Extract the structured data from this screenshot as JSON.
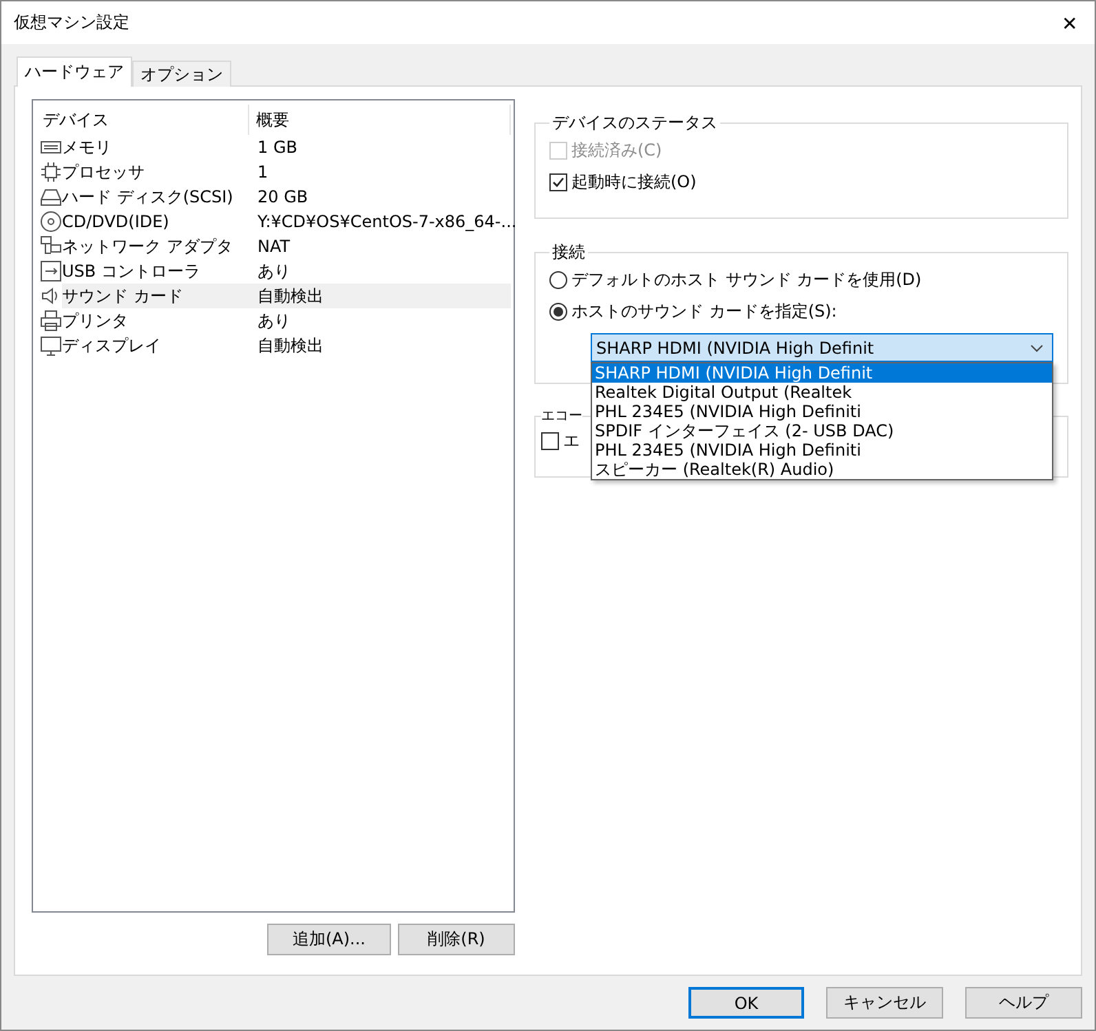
{
  "window": {
    "title": "仮想マシン設定",
    "close": "✕"
  },
  "tabs": [
    {
      "label": "ハードウェア",
      "selected": true
    },
    {
      "label": "オプション",
      "selected": false
    }
  ],
  "device_list": {
    "columns": [
      "デバイス",
      "概要"
    ],
    "rows": [
      {
        "kind": "memory",
        "name": "メモリ",
        "summary": "1 GB",
        "selected": false
      },
      {
        "kind": "cpu",
        "name": "プロセッサ",
        "summary": "1",
        "selected": false
      },
      {
        "kind": "disk",
        "name": "ハード ディスク(SCSI)",
        "summary": "20 GB",
        "selected": false
      },
      {
        "kind": "cd",
        "name": "CD/DVD(IDE)",
        "summary": "Y:¥CD¥OS¥CentOS-7-x86_64-...",
        "selected": false
      },
      {
        "kind": "network",
        "name": "ネットワーク アダプタ",
        "summary": "NAT",
        "selected": false
      },
      {
        "kind": "usb",
        "name": "USB コントローラ",
        "summary": "あり",
        "selected": false
      },
      {
        "kind": "sound",
        "name": "サウンド カード",
        "summary": "自動検出",
        "selected": true
      },
      {
        "kind": "printer",
        "name": "プリンタ",
        "summary": "あり",
        "selected": false
      },
      {
        "kind": "display",
        "name": "ディスプレイ",
        "summary": "自動検出",
        "selected": false
      }
    ]
  },
  "list_buttons": [
    "追加(A)...",
    "削除(R)"
  ],
  "device_status": {
    "title": "デバイスのステータス",
    "options": [
      {
        "label": "接続済み(C)",
        "checked": false,
        "disabled": true
      },
      {
        "label": "起動時に接続(O)",
        "checked": true,
        "disabled": false
      }
    ]
  },
  "connection": {
    "title": "接続",
    "options": [
      {
        "label": "デフォルトのホスト サウンド カードを使用(D)",
        "selected": false
      },
      {
        "label": "ホストのサウンド カードを指定(S):",
        "selected": true
      }
    ],
    "dropdown": {
      "value": "SHARP HDMI (NVIDIA High Definit",
      "expanded": true,
      "options": [
        {
          "label": "SHARP HDMI (NVIDIA High Definit",
          "selected": true
        },
        {
          "label": "Realtek Digital Output (Realtek",
          "selected": false
        },
        {
          "label": "PHL 234E5 (NVIDIA High Definiti",
          "selected": false
        },
        {
          "label": "SPDIF インターフェイス (2- USB DAC)",
          "selected": false
        },
        {
          "label": "PHL 234E5 (NVIDIA High Definiti",
          "selected": false
        },
        {
          "label": "スピーカー (Realtek(R) Audio)",
          "selected": false
        }
      ]
    }
  },
  "echo": {
    "title": "エコー",
    "option": {
      "label": "エ",
      "checked": false
    }
  },
  "dialog_buttons": [
    {
      "label": "OK",
      "default": true
    },
    {
      "label": "キャンセル",
      "default": false
    },
    {
      "label": "ヘルプ",
      "default": false
    }
  ]
}
